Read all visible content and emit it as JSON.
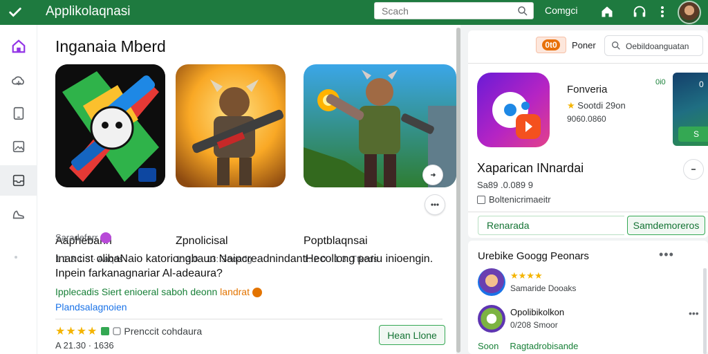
{
  "topbar": {
    "title": "Applikolaqnasi",
    "search_placeholder": "Scach",
    "compat_label": "Comgci",
    "icons": [
      "check-icon",
      "search-icon",
      "home-icon",
      "headset-icon",
      "kebab-menu-icon"
    ]
  },
  "rail": {
    "items": [
      "home-icon",
      "cloud-icon",
      "tablet-icon",
      "image-icon",
      "inbox-icon",
      "shoe-icon"
    ],
    "active_index": 4
  },
  "main": {
    "section_title": "Inganaia Mberd",
    "cards": [
      {
        "name": "Aaphebarirl",
        "meta": "1 1 3 1 3  ·  Aaqds"
      },
      {
        "name": "Zpnolicisal",
        "meta": "1: 2.0 · 13:  Sooadg"
      },
      {
        "name": "Poptblaqnsai",
        "meta": "1: 2 0 · 1 3:  Ttkcds"
      }
    ],
    "sponsor": "Saradefarr",
    "description": "Inancist olibaNaio katoriongbaun NaipcreadnindantHecollong pariu inioengin. Inpein farkanagnariar Al-adeaura?",
    "green_line": "Ipplecadis Siert enioeral saboh deonn",
    "green_highlight": "landrat",
    "blue_link": "Plandsalagnoien",
    "rating_text": "Prenccit cohdaura",
    "install_label": "Hean Llone",
    "bottom_meta": "A 21.30  ·  1636"
  },
  "right": {
    "pill_label": "0t0",
    "poster_label": "Poner",
    "search_text": "Oebildoanguatan",
    "app_name": "Fonveria",
    "app_rating": "Sootdi 29on",
    "app_count": "9060.0860",
    "green_badge": "0i0",
    "banner_num": "0",
    "banner_btn": "S",
    "title_main": "Xaparican INnardai",
    "title_accent": "",
    "sub1": "Sa89 .0.089 9",
    "sub2": "Boltenicrimaeitr",
    "btn_secondary": "Renarada",
    "btn_primary": "Samdemoreros",
    "list_title": "Urebike Googg Peonars",
    "list_items": [
      {
        "title": "★★★★",
        "subtitle": "Samaride Dooaks"
      },
      {
        "title": "Opolibikolkon",
        "subtitle": "0/208 Smoor"
      }
    ],
    "footer_left": "Soon",
    "footer_right": "Ragtadrobisande"
  }
}
